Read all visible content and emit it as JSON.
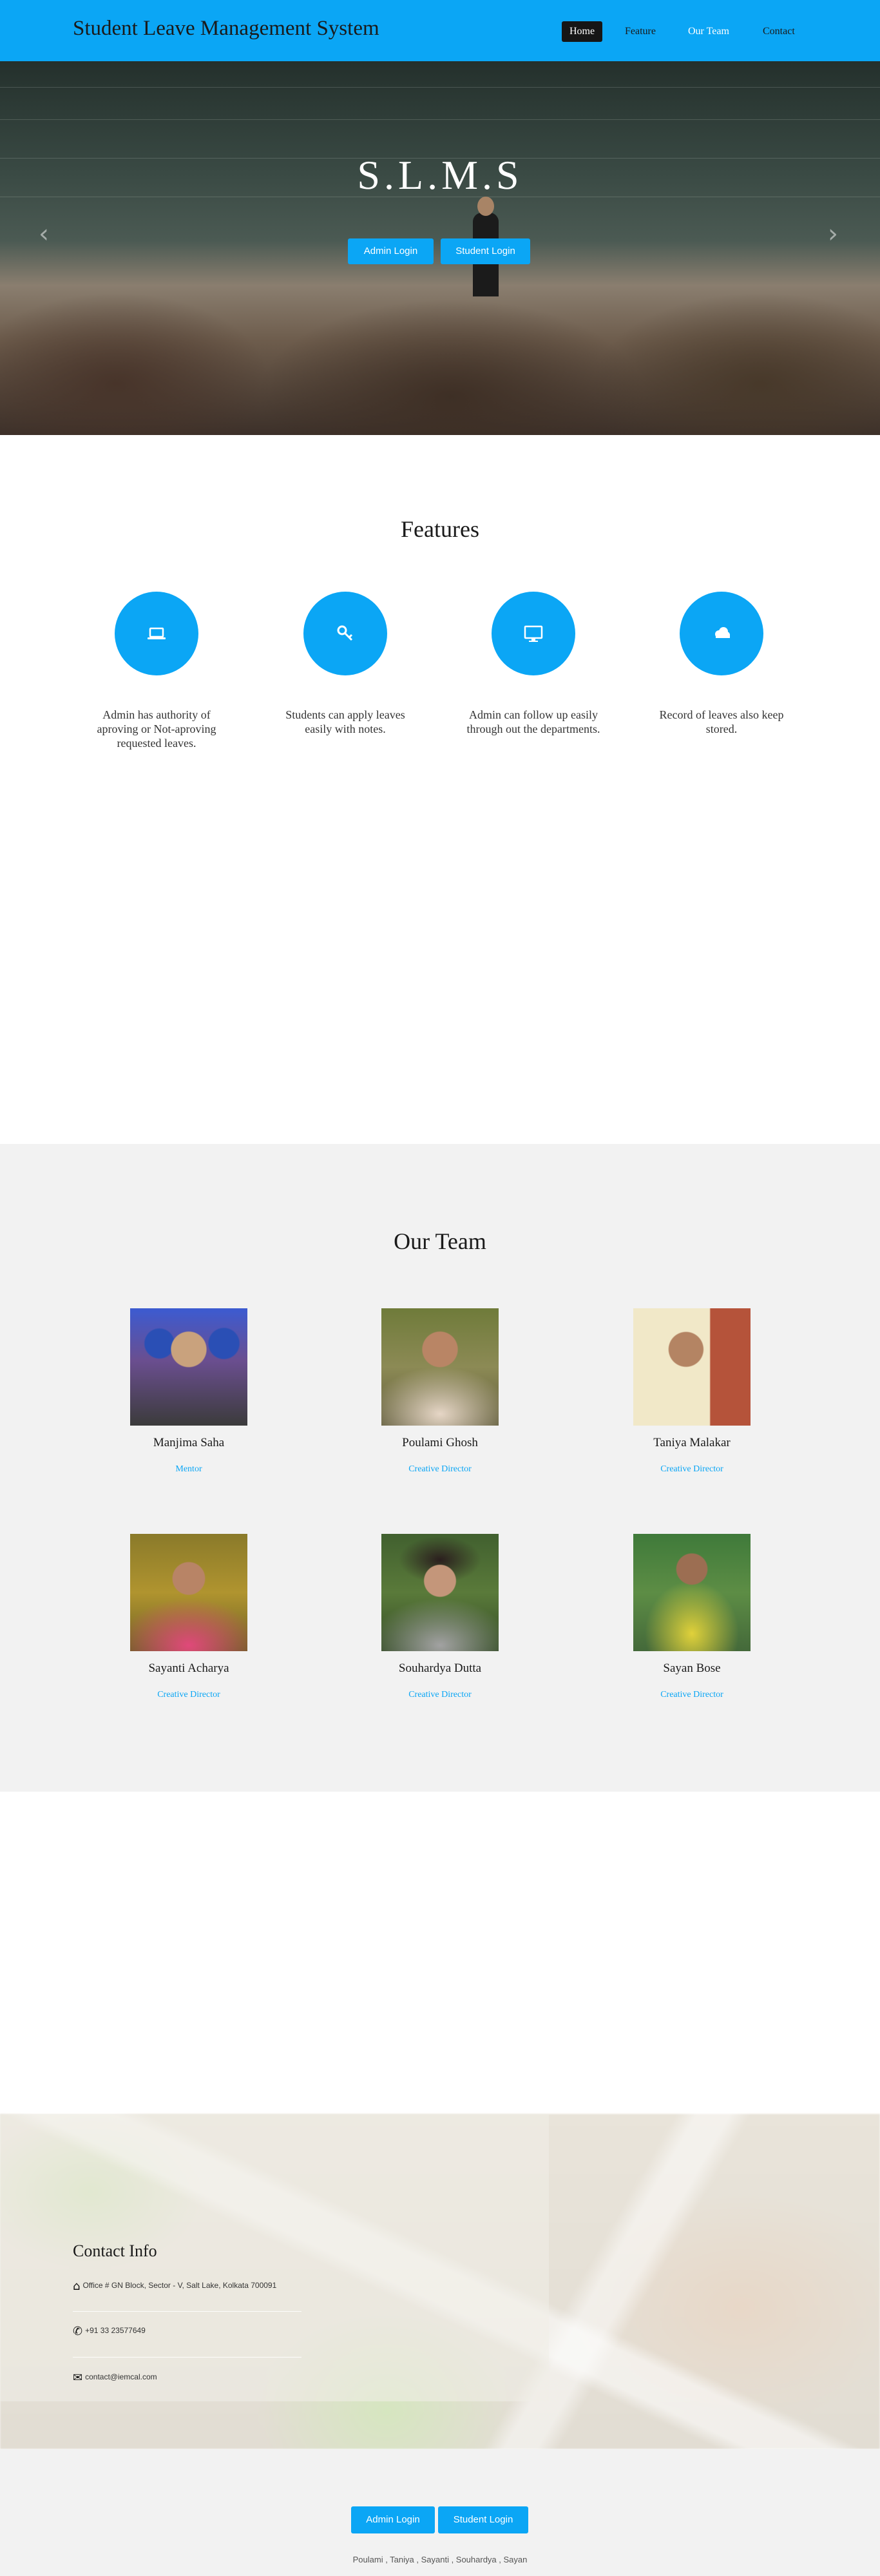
{
  "navbar": {
    "brand": "Student Leave Management System",
    "items": [
      {
        "label": "Home",
        "active": true
      },
      {
        "label": "Feature"
      },
      {
        "label": "Our Team"
      },
      {
        "label": "Contact"
      }
    ]
  },
  "hero": {
    "title": "S.L.M.S",
    "admin_button": "Admin Login",
    "student_button": "Student Login",
    "prev_icon": "chevron-left-icon",
    "next_icon": "chevron-right-icon"
  },
  "features": {
    "title": "Features",
    "items": [
      {
        "icon": "laptop-icon",
        "text": "Admin has authority of aproving or Not-aproving requested leaves."
      },
      {
        "icon": "key-icon",
        "text": "Students can apply leaves easily with notes."
      },
      {
        "icon": "desktop-icon",
        "text": "Admin can follow up easily through out the departments."
      },
      {
        "icon": "cloud-icon",
        "text": "Record of leaves also keep stored."
      }
    ]
  },
  "team": {
    "title": "Our Team",
    "members": [
      {
        "name": "Manjima Saha",
        "role": "Mentor"
      },
      {
        "name": "Poulami Ghosh",
        "role": "Creative Director"
      },
      {
        "name": "Taniya Malakar",
        "role": "Creative Director"
      },
      {
        "name": "Sayanti Acharya",
        "role": "Creative Director"
      },
      {
        "name": "Souhardya Dutta",
        "role": "Creative Director"
      },
      {
        "name": "Sayan Bose",
        "role": "Creative Director"
      }
    ]
  },
  "contact": {
    "title": "Contact Info",
    "address": "Office # GN Block, Sector - V, Salt Lake, Kolkata 700091",
    "phone": "+91 33 23577649",
    "email": "contact@iemcal.com",
    "address_icon": "home-icon",
    "phone_icon": "phone-icon",
    "email_icon": "envelope-icon"
  },
  "footer": {
    "admin_button": "Admin Login",
    "student_button": "Student Login",
    "credits": "Poulami , Taniya , Sayanti , Souhardya , Sayan"
  },
  "colors": {
    "accent": "#0ba6f5",
    "nav_active_bg": "#161616",
    "section_gray": "#f2f2f2"
  }
}
